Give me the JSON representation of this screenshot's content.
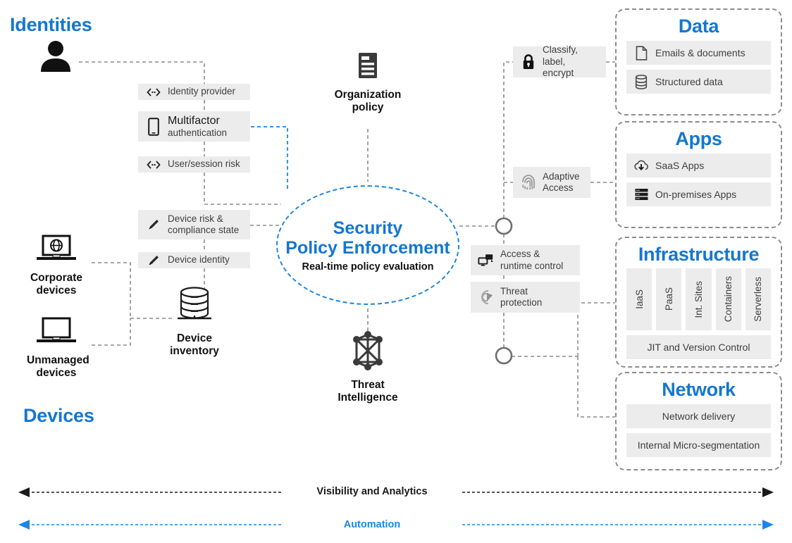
{
  "diagram": {
    "title": "Zero Trust Security Policy Enforcement architecture",
    "accent_blue": "#1477cf",
    "chip_bg": "#ececec",
    "dashed_gray": "#8c8c8c"
  },
  "sections": {
    "identities_label": "Identities",
    "devices_label": "Devices"
  },
  "identity_sources": [
    {
      "name": "user",
      "caption": ""
    }
  ],
  "device_sources": [
    {
      "icon": "laptop-globe-icon",
      "caption": "Corporate\ndevices"
    },
    {
      "icon": "laptop-icon",
      "caption": "Unmanaged\ndevices"
    }
  ],
  "device_inventory": {
    "icon": "database-icon",
    "caption": "Device\ninventory"
  },
  "identity_chips": [
    {
      "icon": "connector-icon",
      "label": "Identity  provider",
      "style": "small"
    },
    {
      "icon": "mobile-phone-icon",
      "label": "Multifactor",
      "sublabel": "authentication",
      "style": "big"
    },
    {
      "icon": "connector-icon",
      "label": "User/session risk",
      "style": "small"
    }
  ],
  "device_chips": [
    {
      "icon": "pencil-icon",
      "label": "Device  risk &\ncompliance  state",
      "style": "small"
    },
    {
      "icon": "pencil-icon",
      "label": "Device  identity",
      "style": "small"
    }
  ],
  "signals": [
    {
      "icon": "document-policy-icon",
      "caption": "Organization\npolicy"
    },
    {
      "icon": "threat-network-icon",
      "caption": "Threat\nIntelligence"
    }
  ],
  "core": {
    "line1": "Security",
    "line2": "Policy  Enforcement",
    "line3": "Real-time policy evaluation"
  },
  "enforcement_chips": [
    {
      "icon": "lock-icon",
      "label": "Classify,\nlabel, encrypt"
    },
    {
      "icon": "fingerprint-icon",
      "label": "Adaptive\nAccess"
    },
    {
      "icon": "access-runtime-icon",
      "label": "Access &\nruntime  control"
    },
    {
      "icon": "threat-shield-icon",
      "label": "Threat\nprotection"
    }
  ],
  "panels": [
    {
      "title": "Data",
      "rows": [
        {
          "icon": "file-icon",
          "label": "Emails & documents"
        },
        {
          "icon": "database-stack-icon",
          "label": "Structured data"
        }
      ]
    },
    {
      "title": "Apps",
      "rows": [
        {
          "icon": "cloud-download-icon",
          "label": "SaaS Apps"
        },
        {
          "icon": "server-rack-icon",
          "label": "On-premises Apps"
        }
      ]
    },
    {
      "title": "Infrastructure",
      "columns": [
        "IaaS",
        "PaaS",
        "Int. Sites",
        "Containers",
        "Serverless"
      ],
      "rows": [
        {
          "icon": "",
          "label": "JIT and Version  Control"
        }
      ]
    },
    {
      "title": "Network",
      "rows": [
        {
          "icon": "",
          "label": "Network delivery"
        },
        {
          "icon": "",
          "label": "Internal Micro-segmentation"
        }
      ]
    }
  ],
  "bands": [
    {
      "label": "Visibility and Analytics",
      "color": "#1a1a1a"
    },
    {
      "label": "Automation",
      "color": "#1c86e8"
    }
  ]
}
